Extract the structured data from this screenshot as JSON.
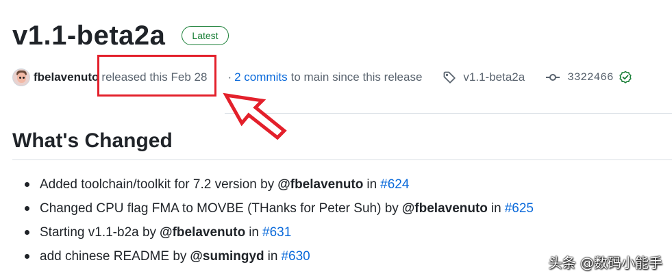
{
  "release": {
    "title": "v1.1-beta2a",
    "badge": "Latest",
    "author": "fbelavenuto",
    "released_text": "released this Feb 28",
    "separator": "·",
    "commits_link": "2 commits",
    "commits_rest": "to main since this release",
    "tag": "v1.1-beta2a",
    "commit_hash": "3322466"
  },
  "section": {
    "heading": "What's Changed"
  },
  "changes": [
    {
      "text": "Added toolchain/toolkit for 7.2 version by",
      "author": "@fbelavenuto",
      "in": "in",
      "pr": "#624"
    },
    {
      "text": "Changed CPU flag FMA to MOVBE (THanks for Peter Suh) by",
      "author": "@fbelavenuto",
      "in": "in",
      "pr": "#625"
    },
    {
      "text": "Starting v1.1-b2a by",
      "author": "@fbelavenuto",
      "in": "in",
      "pr": "#631"
    },
    {
      "text": "add chinese README by",
      "author": "@sumingyd",
      "in": "in",
      "pr": "#630"
    }
  ],
  "watermark": "头条 @数码小能手",
  "icons": {
    "avatar": "avatar",
    "tag": "tag-icon",
    "commit": "git-commit-icon",
    "verified": "check-circle-icon",
    "annotation_arrow": "arrow-icon"
  },
  "colors": {
    "link": "#0969da",
    "badge_green": "#1a7f37",
    "annotation_red": "#e3202b",
    "muted_text": "#59636e"
  }
}
